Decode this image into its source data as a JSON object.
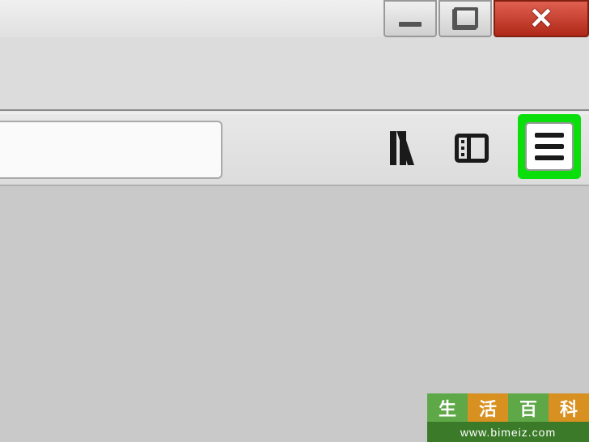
{
  "window_controls": {
    "minimize": "Minimize",
    "maximize": "Restore",
    "close": "Close"
  },
  "toolbar": {
    "search_value": "",
    "search_placeholder": "",
    "library_tooltip": "Library",
    "sidebar_tooltip": "Sidebar",
    "menu_tooltip": "Open menu"
  },
  "highlight": {
    "target": "hamburger-menu-button",
    "color": "#0bdf0b"
  },
  "watermark": {
    "chars": [
      "生",
      "活",
      "百",
      "科"
    ],
    "url": "www.bimeiz.com"
  }
}
